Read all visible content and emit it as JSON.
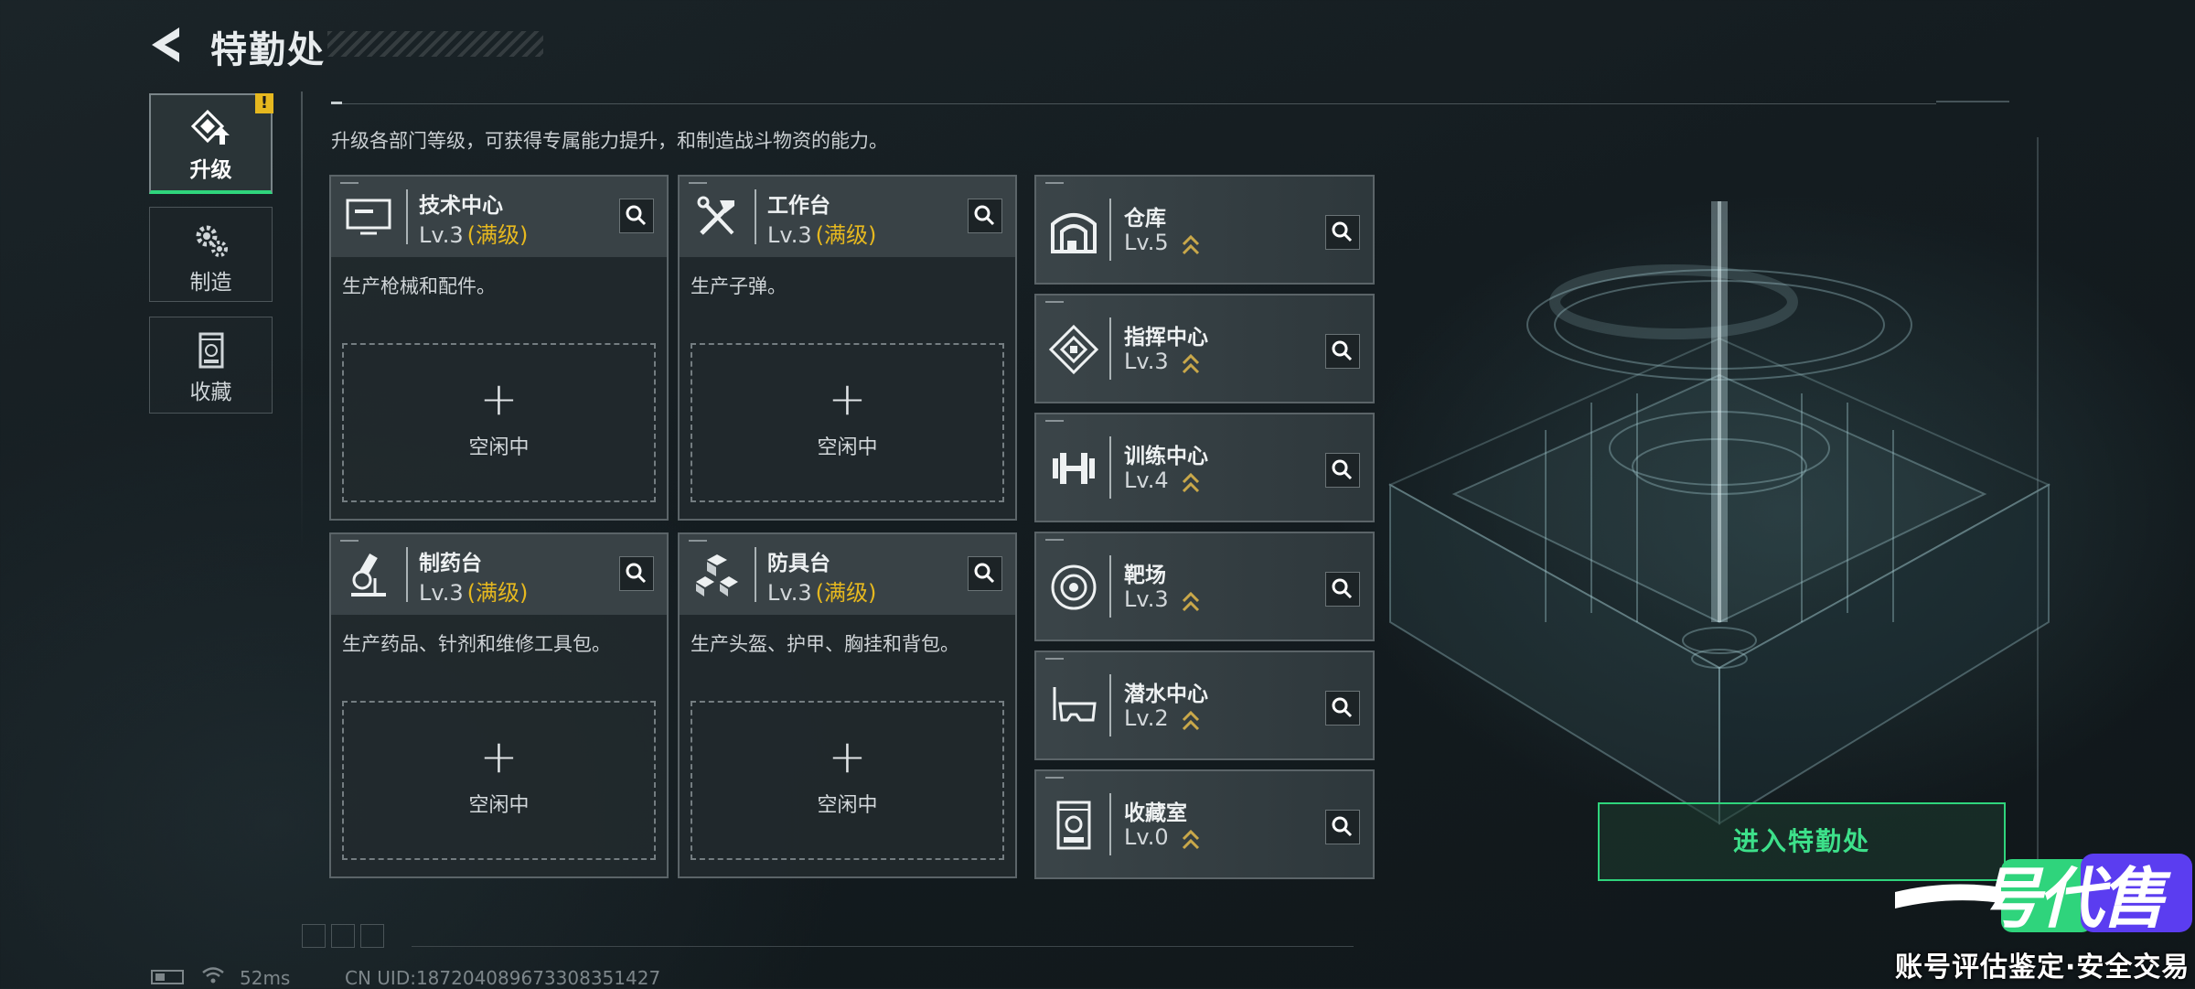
{
  "header": {
    "title": "特勤处"
  },
  "nav": {
    "items": [
      {
        "label": "升级",
        "icon": "upgrade-icon",
        "active": true,
        "alert": "!"
      },
      {
        "label": "制造",
        "icon": "gears-icon",
        "active": false
      },
      {
        "label": "收藏",
        "icon": "collection-icon",
        "active": false
      }
    ]
  },
  "main": {
    "description": "升级各部门等级，可获得专属能力提升，和制造战斗物资的能力。",
    "departments": [
      {
        "name": "技术中心",
        "level": "Lv.3",
        "max": "(满级)",
        "desc": "生产枪械和配件。",
        "slot_plus": "+",
        "slot_status": "空闲中",
        "icon": "computer-icon"
      },
      {
        "name": "工作台",
        "level": "Lv.3",
        "max": "(满级)",
        "desc": "生产子弹。",
        "slot_plus": "+",
        "slot_status": "空闲中",
        "icon": "tools-icon"
      },
      {
        "name": "制药台",
        "level": "Lv.3",
        "max": "(满级)",
        "desc": "生产药品、针剂和维修工具包。",
        "slot_plus": "+",
        "slot_status": "空闲中",
        "icon": "microscope-icon"
      },
      {
        "name": "防具台",
        "level": "Lv.3",
        "max": "(满级)",
        "desc": "生产头盔、护甲、胸挂和背包。",
        "slot_plus": "+",
        "slot_status": "空闲中",
        "icon": "armor-blocks-icon"
      }
    ],
    "facilities": [
      {
        "name": "仓库",
        "level": "Lv.5",
        "icon": "warehouse-icon"
      },
      {
        "name": "指挥中心",
        "level": "Lv.3",
        "icon": "chip-icon"
      },
      {
        "name": "训练中心",
        "level": "Lv.4",
        "icon": "dumbbell-icon"
      },
      {
        "name": "靶场",
        "level": "Lv.3",
        "icon": "target-icon"
      },
      {
        "name": "潜水中心",
        "level": "Lv.2",
        "icon": "diving-mask-icon"
      },
      {
        "name": "收藏室",
        "level": "Lv.0",
        "icon": "display-case-icon"
      }
    ],
    "enter_button": "进入特勤处"
  },
  "status_bar": {
    "ping": "52ms",
    "uid": "CN UID:187204089673308351427"
  },
  "watermark": {
    "logo_text": "一号代售",
    "tagline": "账号评估鉴定·安全交易"
  },
  "colors": {
    "accent_green": "#2fd47c",
    "max_gold": "#e6b81f",
    "upgrade_arrow": "#c9a84a"
  }
}
